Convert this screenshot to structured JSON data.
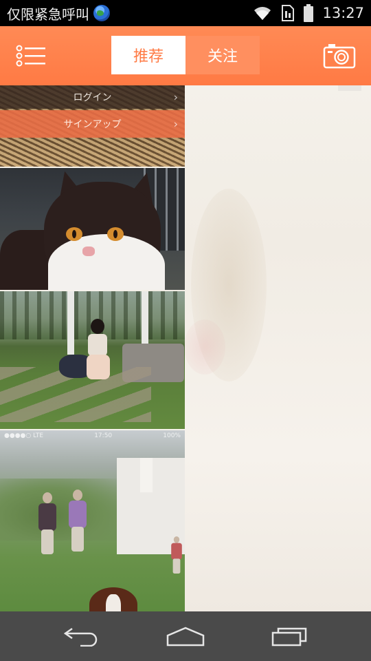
{
  "status_bar": {
    "carrier_text": "仅限紧急呼叫",
    "time": "13:27",
    "icons": [
      "globe-icon",
      "wifi-icon",
      "sim-icon",
      "battery-icon"
    ]
  },
  "app_bar": {
    "menu_icon": "list-menu-icon",
    "tabs": [
      {
        "label": "推荐",
        "active": true
      },
      {
        "label": "关注",
        "active": false
      }
    ],
    "camera_icon": "camera-icon",
    "accent_color": "#ff7a44"
  },
  "feed": {
    "login_card": {
      "login_label": "ログイン",
      "signup_label": "サインアップ"
    },
    "phone_status_text": {
      "left": "●●●●○ LTE",
      "center": "17:50",
      "right": "100%"
    }
  },
  "nav_bar": {
    "icons": [
      "back-icon",
      "home-icon",
      "recent-apps-icon"
    ]
  }
}
